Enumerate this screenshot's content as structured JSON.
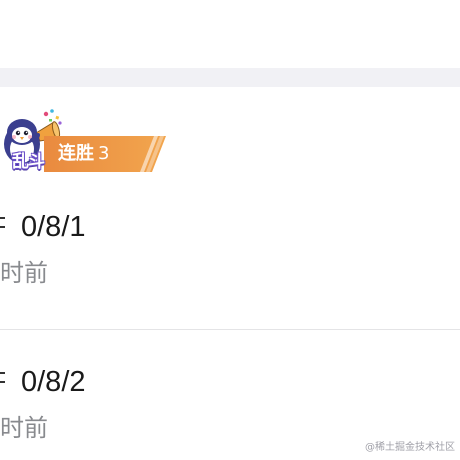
{
  "streak": {
    "mode_label": "乱斗",
    "label": "连胜",
    "count": "3",
    "colors": {
      "start": "#e98a3f",
      "end": "#f2a64e"
    }
  },
  "mascot": {
    "icon": "penguin-mascot-with-megaphone-icon"
  },
  "matches": [
    {
      "kda": "0/8/1",
      "time": "时前"
    },
    {
      "kda": "0/8/2",
      "time": "时前"
    }
  ],
  "watermark": "@稀土掘金技术社区",
  "colors": {
    "band": "#f1f1f5",
    "divider": "#e4e4e6",
    "text_primary": "#1a1a1a",
    "text_secondary": "#888a8e"
  }
}
